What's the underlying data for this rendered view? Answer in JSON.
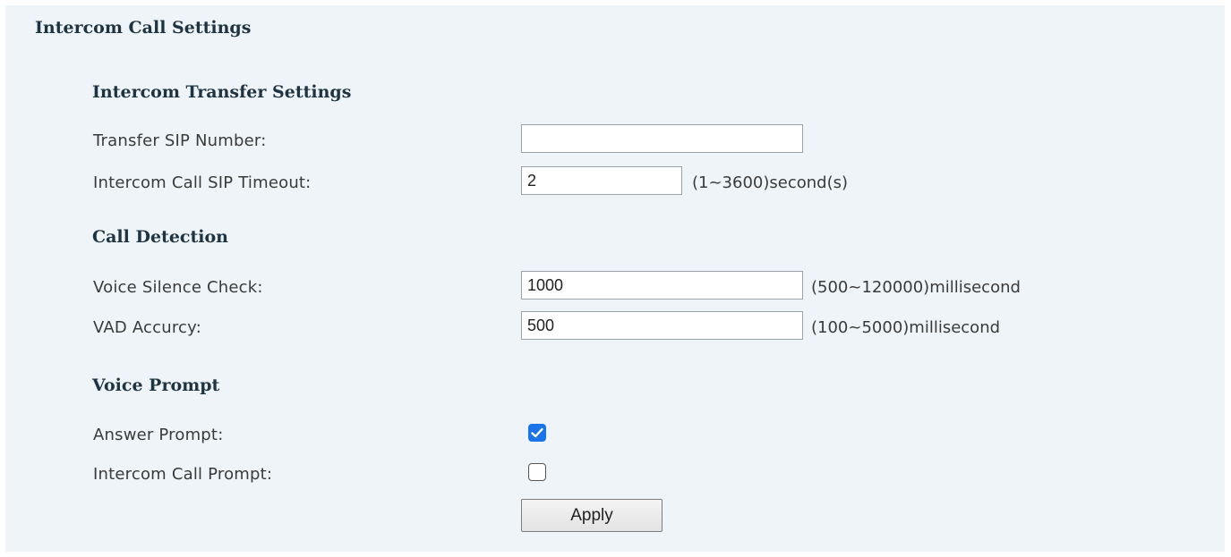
{
  "page": {
    "title": "Intercom Call Settings"
  },
  "transfer": {
    "heading": "Intercom Transfer Settings",
    "sip_number": {
      "label": "Transfer SIP Number:",
      "value": ""
    },
    "sip_timeout": {
      "label": "Intercom Call SIP Timeout:",
      "value": "2",
      "hint": "(1~3600)second(s)"
    }
  },
  "detection": {
    "heading": "Call Detection",
    "silence_check": {
      "label": "Voice Silence Check:",
      "value": "1000",
      "hint": "(500~120000)millisecond"
    },
    "vad_accuracy": {
      "label": "VAD Accurcy:",
      "value": "500",
      "hint": "(100~5000)millisecond"
    }
  },
  "prompt": {
    "heading": "Voice Prompt",
    "answer_prompt": {
      "label": "Answer Prompt:",
      "checked": true
    },
    "intercom_call_prompt": {
      "label": "Intercom Call Prompt:",
      "checked": false
    }
  },
  "actions": {
    "apply_label": "Apply"
  },
  "colors": {
    "panel_bg": "#eef4f7",
    "heading": "#1f3443",
    "checkbox_accent": "#1a73e8"
  },
  "icons": {
    "checked": "checkmark-icon"
  }
}
